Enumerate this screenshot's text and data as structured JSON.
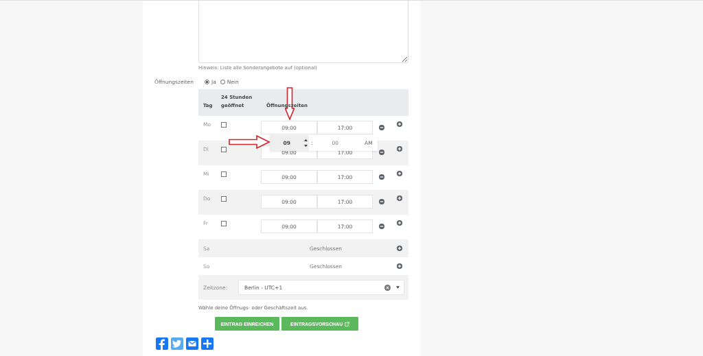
{
  "special_offers": {
    "hint": "Hinweis: Liste alle Sonderangebote auf (optional)"
  },
  "opening_hours": {
    "label": "Öffnungszeiten",
    "options": [
      {
        "label": "Ja",
        "selected": true
      },
      {
        "label": "Nein",
        "selected": false
      }
    ]
  },
  "table": {
    "columns": [
      "Tag",
      "24 Stunden geöffnet",
      "Öffnungszeiten"
    ],
    "rows": [
      {
        "kind": "hours",
        "day": "Mo",
        "open_24h": false,
        "from": "09:00",
        "to": "17:00"
      },
      {
        "kind": "hours",
        "day": "Di",
        "open_24h": false,
        "from": "09:00",
        "to": "17:00"
      },
      {
        "kind": "hours",
        "day": "Mi",
        "open_24h": false,
        "from": "09:00",
        "to": "17:00"
      },
      {
        "kind": "hours",
        "day": "Do",
        "open_24h": false,
        "from": "09:00",
        "to": "17:00"
      },
      {
        "kind": "hours",
        "day": "Fr",
        "open_24h": false,
        "from": "09:00",
        "to": "17:00"
      },
      {
        "kind": "closed",
        "day": "Sa",
        "status": "Geschlossen"
      },
      {
        "kind": "closed",
        "day": "So",
        "status": "Geschlossen"
      }
    ]
  },
  "time_picker": {
    "hours": "09",
    "separator": ":",
    "minutes": "00",
    "period": "AM"
  },
  "timezone": {
    "label": "Zeitzone:",
    "value": "Berlin - UTC+1"
  },
  "help_text": "Wähle deine Öffnugs- oder Geschäftszeit aus.",
  "buttons": [
    {
      "label": "EINTRAG EINREICHEN",
      "kind": "plain"
    },
    {
      "label": "EINTRAGSVORSCHAU",
      "kind": "external"
    }
  ]
}
